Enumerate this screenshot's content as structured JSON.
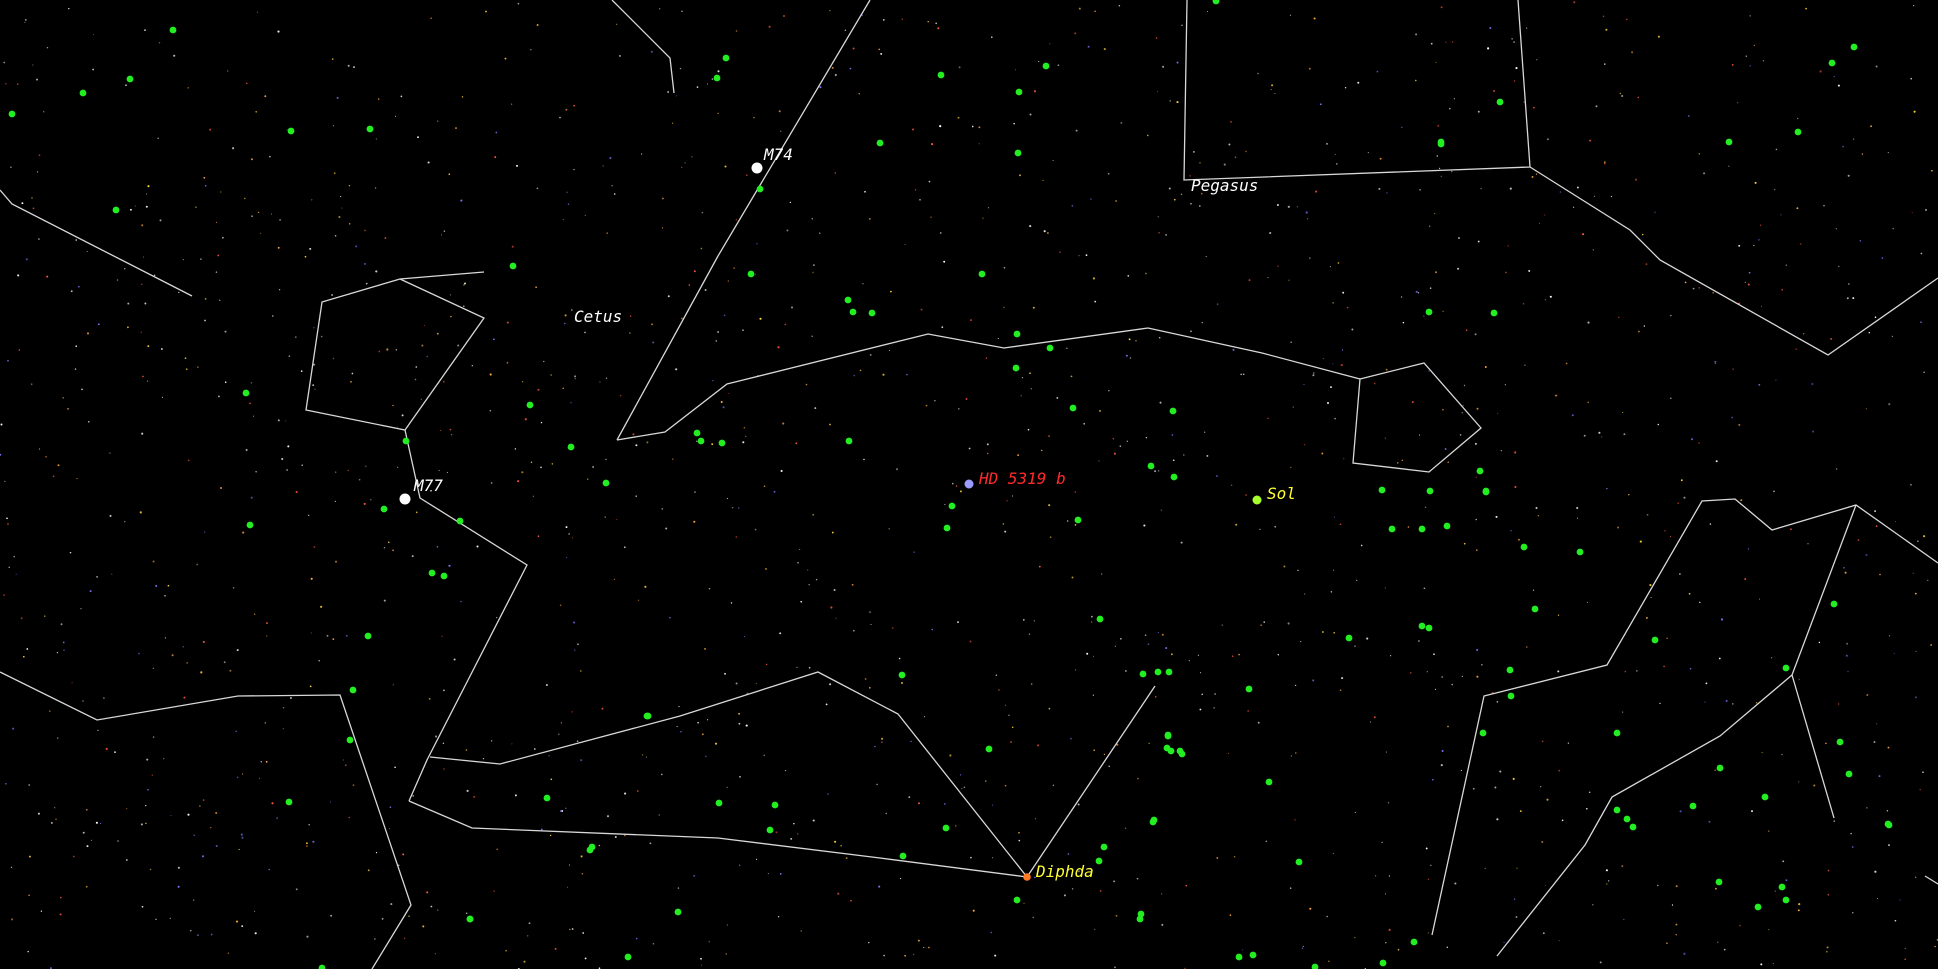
{
  "labels": {
    "pegasus": "Pegasus",
    "cetus": "Cetus",
    "m74": "M74",
    "m77": "M77",
    "target": "HD 5319 b",
    "sol": "Sol",
    "diphda": "Diphda"
  },
  "colors": {
    "background": "#000000",
    "constellation_line": "#d8d8d8",
    "neighbor_star": "#22ee22",
    "target_label": "#ff2a2a",
    "target_marker": "#9a9aff",
    "star_label": "#ffff33",
    "deep_sky_label": "#ffffff"
  }
}
